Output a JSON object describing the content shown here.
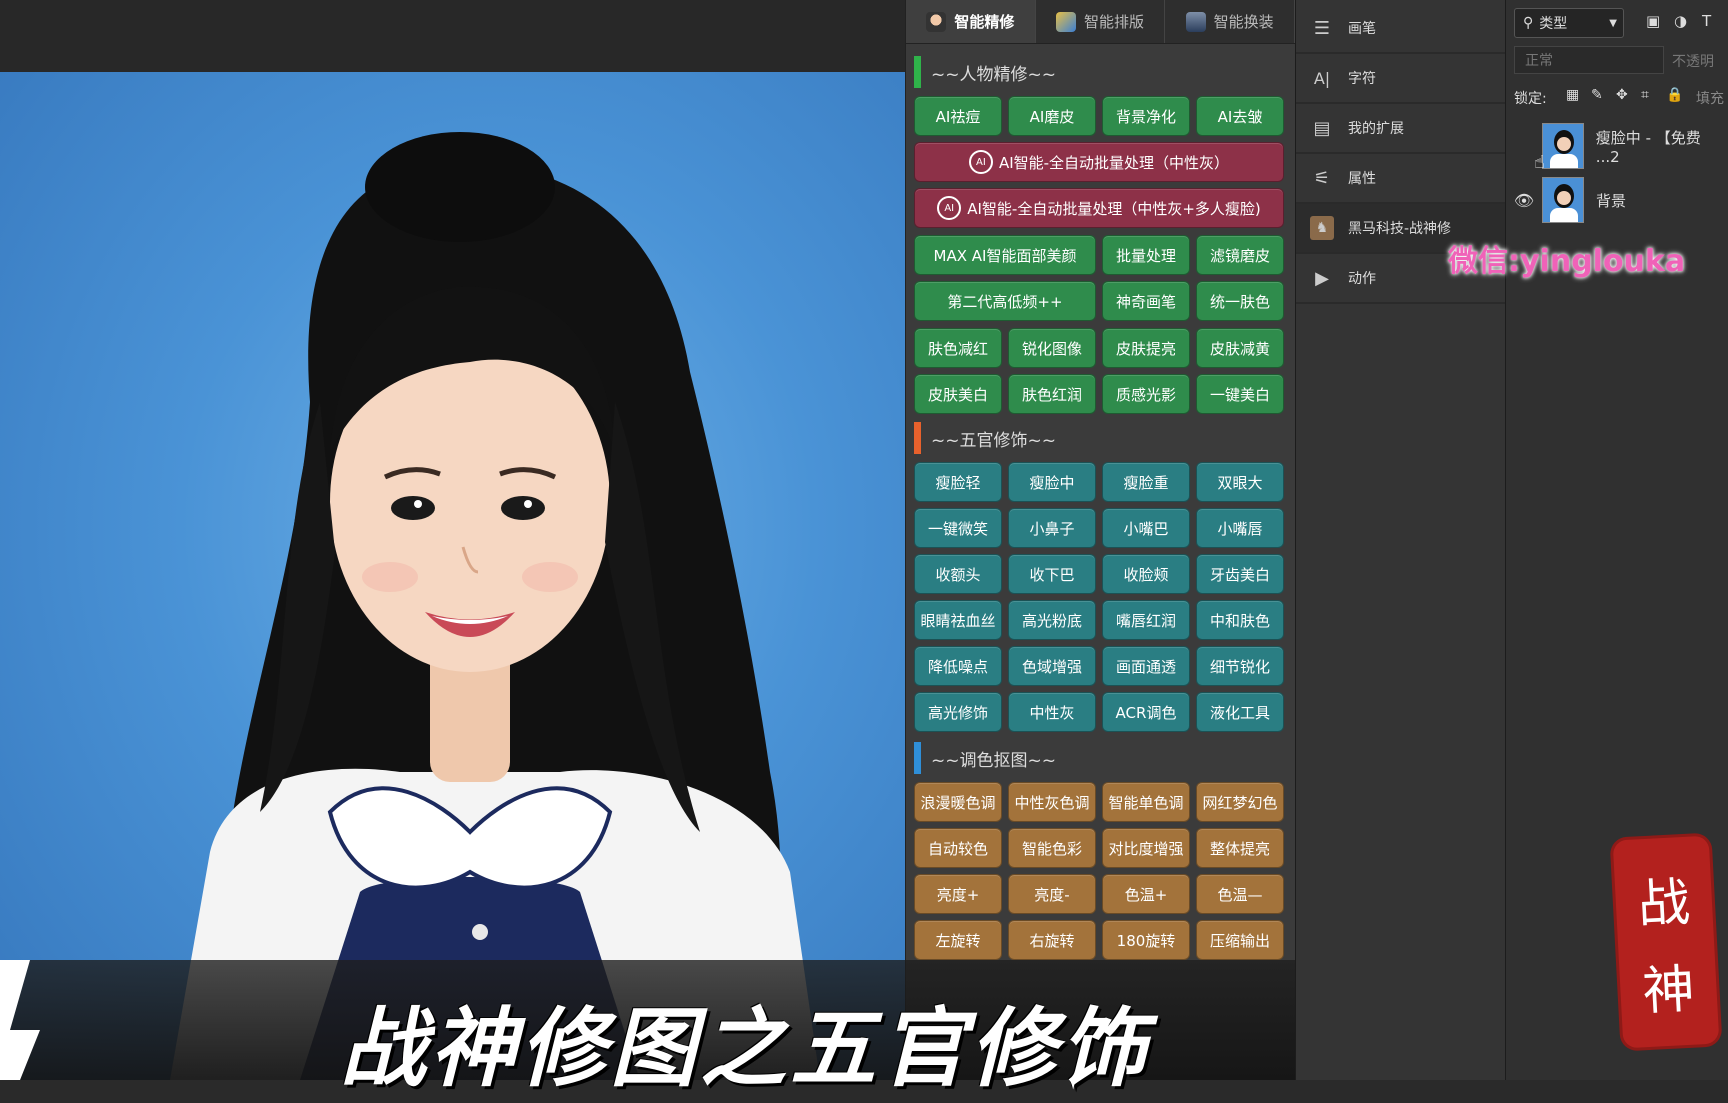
{
  "plugin": {
    "tabs": [
      {
        "label": "智能精修",
        "icon": "avatar-icon",
        "active": true
      },
      {
        "label": "智能排版",
        "icon": "layout-icon",
        "active": false
      },
      {
        "label": "智能换装",
        "icon": "suit-icon",
        "active": false
      }
    ],
    "sections": [
      {
        "title": "~~人物精修~~",
        "color": "#2fb34a"
      },
      {
        "title": "~~五官修饰~~",
        "color": "#e8612c"
      },
      {
        "title": "~~调色抠图~~",
        "color": "#2f8fd8"
      }
    ],
    "retouch_row1": [
      "AI祛痘",
      "AI磨皮",
      "背景净化",
      "AI去皱"
    ],
    "ai_batch_1": "AI智能-全自动批量处理（中性灰）",
    "ai_batch_2": "AI智能-全自动批量处理（中性灰+多人瘦脸)",
    "retouch_row2": [
      "MAX AI智能面部美颜",
      "批量处理",
      "滤镜磨皮"
    ],
    "retouch_row3": [
      "第二代高低频++",
      "神奇画笔",
      "统一肤色"
    ],
    "retouch_row4": [
      "肤色减红",
      "锐化图像",
      "皮肤提亮",
      "皮肤减黄"
    ],
    "retouch_row5": [
      "皮肤美白",
      "肤色红润",
      "质感光影",
      "一键美白"
    ],
    "facial_rows": [
      [
        "瘦脸轻",
        "瘦脸中",
        "瘦脸重",
        "双眼大"
      ],
      [
        "一键微笑",
        "小鼻子",
        "小嘴巴",
        "小嘴唇"
      ],
      [
        "收额头",
        "收下巴",
        "收脸颊",
        "牙齿美白"
      ],
      [
        "眼睛祛血丝",
        "高光粉底",
        "嘴唇红润",
        "中和肤色"
      ],
      [
        "降低噪点",
        "色域增强",
        "画面通透",
        "细节锐化"
      ],
      [
        "高光修饰",
        "中性灰",
        "ACR调色",
        "液化工具"
      ]
    ],
    "color_rows": [
      [
        "浪漫暖色调",
        "中性灰色调",
        "智能单色调",
        "网红梦幻色"
      ],
      [
        "自动较色",
        "智能色彩",
        "对比度增强",
        "整体提亮"
      ],
      [
        "亮度+",
        "亮度-",
        "色温+",
        "色温—"
      ],
      [
        "左旋转",
        "右旋转",
        "180旋转",
        "压缩输出"
      ]
    ]
  },
  "adjust_panel": {
    "items": [
      {
        "label": "画笔",
        "icon": "brush-settings-icon"
      },
      {
        "label": "字符",
        "icon": "character-icon"
      },
      {
        "label": "我的扩展",
        "icon": "extensions-icon"
      },
      {
        "label": "属性",
        "icon": "properties-icon"
      },
      {
        "label": "黑马科技-战神修",
        "icon": "horse-icon"
      },
      {
        "label": "动作",
        "icon": "play-icon"
      }
    ]
  },
  "layers": {
    "filter_label": "类型",
    "blend_mode": "正常",
    "opacity_label": "不透明",
    "lock_label": "锁定:",
    "fill_label": "填充",
    "items": [
      {
        "name": "瘦脸中 - 【免费 ...2",
        "visible": false
      },
      {
        "name": "背景",
        "visible": true
      }
    ]
  },
  "overlay": {
    "watermark": "微信:yinglouka",
    "subtitle": "战神修图之五官修饰",
    "seal_top": "战",
    "seal_bottom": "神"
  }
}
